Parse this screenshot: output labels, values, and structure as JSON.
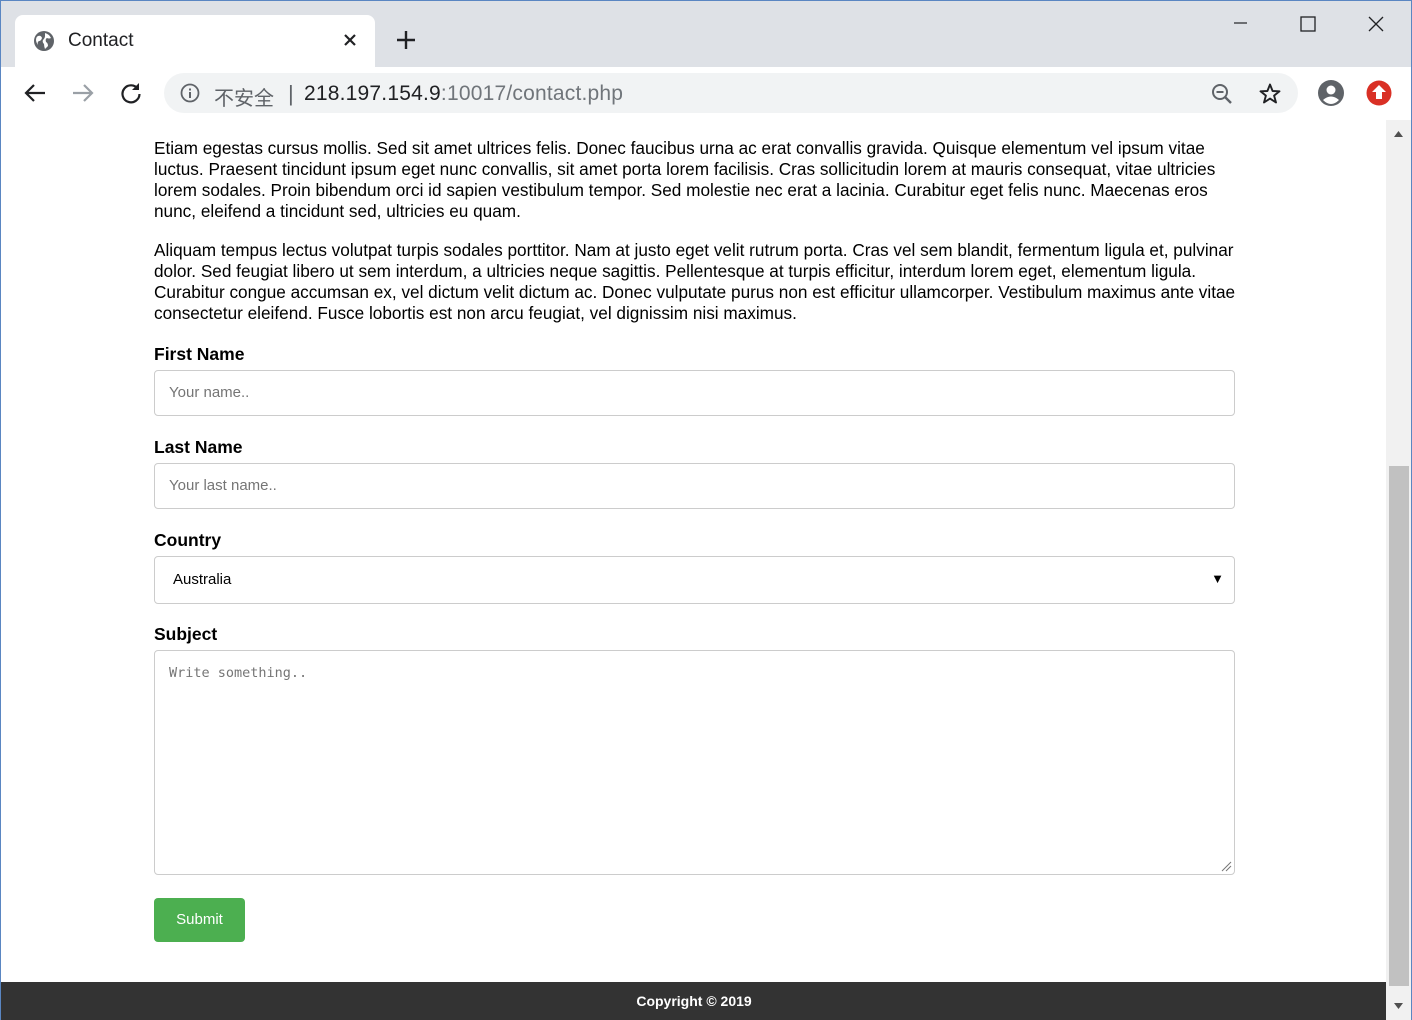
{
  "browser": {
    "tab_title": "Contact",
    "insecure_label": "不安全",
    "url_host": "218.197.154.9",
    "url_rest": ":10017/contact.php"
  },
  "page": {
    "paragraphs": [
      "Etiam egestas cursus mollis. Sed sit amet ultrices felis. Donec faucibus urna ac erat convallis gravida. Quisque elementum vel ipsum vitae luctus. Praesent tincidunt ipsum eget nunc convallis, sit amet porta lorem facilisis. Cras sollicitudin lorem at mauris consequat, vitae ultricies lorem sodales. Proin bibendum orci id sapien vestibulum tempor. Sed molestie nec erat a lacinia. Curabitur eget felis nunc. Maecenas eros nunc, eleifend a tincidunt sed, ultricies eu quam.",
      "Aliquam tempus lectus volutpat turpis sodales porttitor. Nam at justo eget velit rutrum porta. Cras vel sem blandit, fermentum ligula et, pulvinar dolor. Sed feugiat libero ut sem interdum, a ultricies neque sagittis. Pellentesque at turpis efficitur, interdum lorem eget, elementum ligula. Curabitur congue accumsan ex, vel dictum velit dictum ac. Donec vulputate purus non est efficitur ullamcorper. Vestibulum maximus ante vitae consectetur eleifend. Fusce lobortis est non arcu feugiat, vel dignissim nisi maximus."
    ],
    "form": {
      "first_name_label": "First Name",
      "first_name_placeholder": "Your name..",
      "last_name_label": "Last Name",
      "last_name_placeholder": "Your last name..",
      "country_label": "Country",
      "country_value": "Australia",
      "subject_label": "Subject",
      "subject_placeholder": "Write something..",
      "submit_label": "Submit"
    },
    "footer": "Copyright © 2019"
  },
  "colors": {
    "submit_bg": "#4caf50",
    "footer_bg": "#333333",
    "update_badge": "#d93025"
  }
}
